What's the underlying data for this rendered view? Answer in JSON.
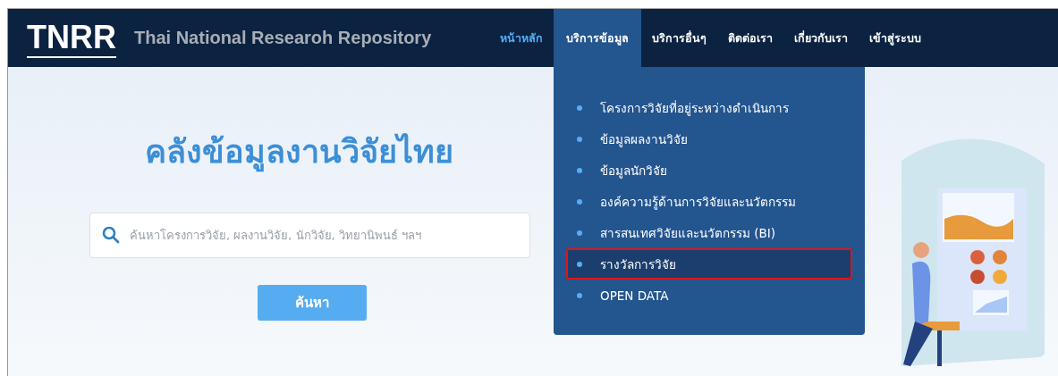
{
  "header": {
    "logo": "TNRR",
    "subtitle": "Thai National Researoh Repository"
  },
  "nav": [
    {
      "label": "หน้าหลัก",
      "selected": true,
      "expanded": false
    },
    {
      "label": "บริการข้อมูล",
      "selected": false,
      "expanded": true
    },
    {
      "label": "บริการอื่นๆ",
      "selected": false,
      "expanded": false
    },
    {
      "label": "ติดต่อเรา",
      "selected": false,
      "expanded": false
    },
    {
      "label": "เกี่ยวกับเรา",
      "selected": false,
      "expanded": false
    },
    {
      "label": "เข้าสู่ระบบ",
      "selected": false,
      "expanded": false
    }
  ],
  "dropdown": {
    "items": [
      {
        "label": "โครงการวิจัยที่อยู่ระหว่างดำเนินการ",
        "selected": false,
        "outlined": false
      },
      {
        "label": "ข้อมูลผลงานวิจัย",
        "selected": false,
        "outlined": false
      },
      {
        "label": "ข้อมูลนักวิจัย",
        "selected": false,
        "outlined": false
      },
      {
        "label": "องค์ความรู้ด้านการวิจัยและนวัตกรรม",
        "selected": false,
        "outlined": false
      },
      {
        "label": "สารสนเทศวิจัยและนวัตกรรม (BI)",
        "selected": false,
        "outlined": false
      },
      {
        "label": "รางวัลการวิจัย",
        "selected": true,
        "outlined": true
      },
      {
        "label": "OPEN DATA",
        "selected": false,
        "outlined": false
      }
    ]
  },
  "hero": {
    "title": "คลังข้อมูลงานวิจัยไทย",
    "search": {
      "placeholder": "ค้นหาโครงการวิจัย, ผลงานวิจัย, นักวิจัย, วิทยานิพนธ์ ฯลฯ"
    },
    "button": "ค้นหา"
  }
}
